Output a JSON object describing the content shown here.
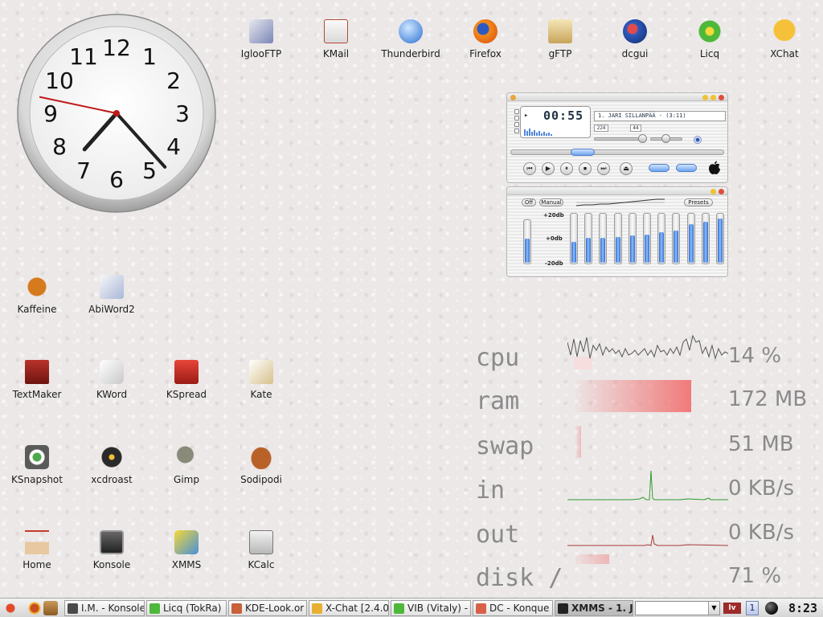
{
  "desktop_icons": [
    {
      "label": "IglooFTP",
      "icon": "iglooftp-icon"
    },
    {
      "label": "KMail",
      "icon": "kmail-icon"
    },
    {
      "label": "Thunderbird",
      "icon": "thunderbird-icon"
    },
    {
      "label": "Firefox",
      "icon": "firefox-icon"
    },
    {
      "label": "gFTP",
      "icon": "gftp-icon"
    },
    {
      "label": "dcgui",
      "icon": "dcgui-icon"
    },
    {
      "label": "Licq",
      "icon": "licq-icon"
    },
    {
      "label": "XChat",
      "icon": "xchat-icon"
    },
    {
      "label": "Kaffeine",
      "icon": "kaffeine-icon"
    },
    {
      "label": "AbiWord2",
      "icon": "abiword-icon"
    },
    {
      "label": "TextMaker",
      "icon": "textmaker-icon"
    },
    {
      "label": "KWord",
      "icon": "kword-icon"
    },
    {
      "label": "KSpread",
      "icon": "kspread-icon"
    },
    {
      "label": "Kate",
      "icon": "kate-icon"
    },
    {
      "label": "KSnapshot",
      "icon": "ksnapshot-icon"
    },
    {
      "label": "xcdroast",
      "icon": "xcdroast-icon"
    },
    {
      "label": "Gimp",
      "icon": "gimp-icon"
    },
    {
      "label": "Sodipodi",
      "icon": "sodipodi-icon"
    },
    {
      "label": "Home",
      "icon": "home-icon"
    },
    {
      "label": "Konsole",
      "icon": "konsole-icon"
    },
    {
      "label": "XMMS",
      "icon": "xmms-icon"
    },
    {
      "label": "KCalc",
      "icon": "kcalc-icon"
    }
  ],
  "clock": {
    "numerals": [
      "12",
      "1",
      "2",
      "3",
      "4",
      "5",
      "6",
      "7",
      "8",
      "9",
      "10",
      "11"
    ],
    "hour": 7,
    "minute": 23,
    "second": 47
  },
  "xmms": {
    "time": "00:55",
    "song_title": "1. JARI SILLANPÄÄ -   (3:11)",
    "bitrate": "224",
    "samplerate": "44",
    "tb_text": "TB",
    "eq_off": "Off",
    "eq_manual": "Manual",
    "eq_presets": "Presets",
    "eq_top": "+20db",
    "eq_mid": "+0db",
    "eq_bot": "-20db",
    "eq_levels": [
      0.55,
      0.42,
      0.5,
      0.5,
      0.52,
      0.55,
      0.56,
      0.62,
      0.65,
      0.78,
      0.82,
      0.88
    ],
    "transport": [
      "⏮",
      "▶",
      "⏸",
      "⏹",
      "⏭",
      "⏏"
    ]
  },
  "monitor": {
    "cpu": {
      "label": "cpu",
      "value": "14 %"
    },
    "ram": {
      "label": "ram",
      "value": "172 MB",
      "level": 0.82
    },
    "swap": {
      "label": "swap",
      "value": "51 MB",
      "level": 0.04
    },
    "in": {
      "label": "in",
      "value": "0 KB/s"
    },
    "out": {
      "label": "out",
      "value": "0 KB/s"
    },
    "disk": {
      "label": "disk /",
      "value": "71 %",
      "level": 0.24
    }
  },
  "taskbar": {
    "tasks": [
      {
        "label": "I.M. - Konsole",
        "icon": "konsole-icon"
      },
      {
        "label": "Licq (TokRa)",
        "icon": "licq-icon"
      },
      {
        "label": "KDE-Look.or",
        "icon": "kde-icon"
      },
      {
        "label": "X-Chat [2.4.0",
        "icon": "xchat-icon"
      },
      {
        "label": "VIB (Vitaly) -",
        "icon": "licq-icon"
      },
      {
        "label": "DC - Konque",
        "icon": "konqueror-icon"
      },
      {
        "label": "XMMS - 1. Ja",
        "icon": "xmms-icon"
      }
    ],
    "desktop_number": "1",
    "keyboard_layout": "lv",
    "clock_text": "8:23"
  },
  "colors": {
    "ram_bar": "#f08a8a",
    "net_in": "#2c9c2c",
    "net_out": "#a83a3a",
    "accent_blue": "#3f7fd9"
  }
}
